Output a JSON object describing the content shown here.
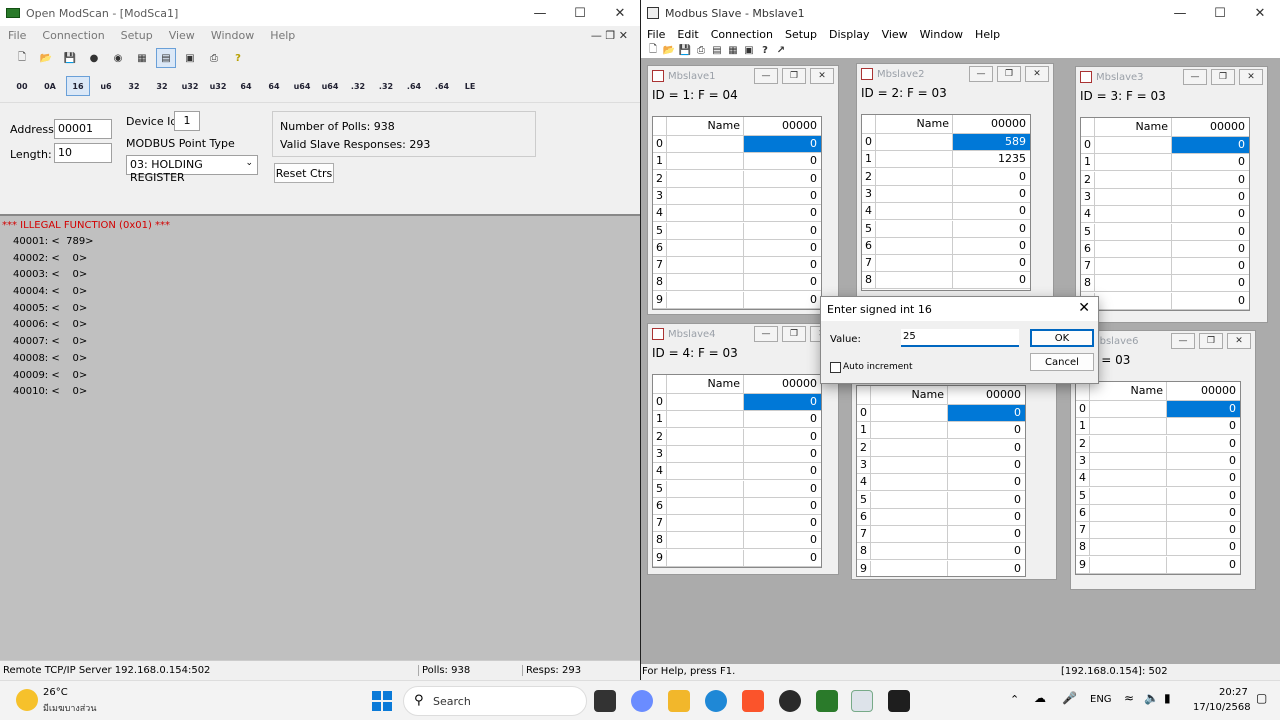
{
  "modscan": {
    "title": "Open ModScan - [ModSca1]",
    "menu": [
      "File",
      "Connection",
      "Setup",
      "View",
      "Window",
      "Help"
    ],
    "types": [
      "00",
      "0A",
      "16",
      "u6",
      "32",
      "32",
      "u32",
      "u32",
      "64",
      "64",
      "u64",
      "u64",
      ".32",
      ".32",
      ".64",
      ".64",
      "LE"
    ],
    "address_label": "Address:",
    "address": "00001",
    "length_label": "Length:",
    "length": "10",
    "device_id_label": "Device Id:",
    "device_id": "1",
    "point_type_label": "MODBUS Point Type",
    "point_type": "03: HOLDING REGISTER",
    "polls": "Number of Polls: 938",
    "valid": "Valid Slave Responses: 293",
    "reset": "Reset Ctrs",
    "error": "*** ILLEGAL FUNCTION (0x01) ***",
    "registers": [
      "40001: <  789>",
      "40002: <    0>",
      "40003: <    0>",
      "40004: <    0>",
      "40005: <    0>",
      "40006: <    0>",
      "40007: <    0>",
      "40008: <    0>",
      "40009: <    0>",
      "40010: <    0>"
    ],
    "status_server": "Remote TCP/IP Server 192.168.0.154:502",
    "status_polls": "Polls: 938",
    "status_resps": "Resps: 293"
  },
  "mbslave": {
    "title": "Modbus Slave - Mbslave1",
    "menu": [
      "File",
      "Edit",
      "Connection",
      "Setup",
      "Display",
      "View",
      "Window",
      "Help"
    ],
    "status_help": "For Help, press F1.",
    "status_addr": "[192.168.0.154]: 502",
    "slaves": [
      {
        "title": "Mbslave1",
        "id": "ID = 1: F = 04",
        "values": [
          "0",
          "0",
          "0",
          "0",
          "0",
          "0",
          "0",
          "0",
          "0",
          "0"
        ]
      },
      {
        "title": "Mbslave2",
        "id": "ID = 2: F = 03",
        "values": [
          "589",
          "1235",
          "0",
          "0",
          "0",
          "0",
          "0",
          "0",
          "0"
        ]
      },
      {
        "title": "Mbslave3",
        "id": "ID = 3: F = 03",
        "values": [
          "0",
          "0",
          "0",
          "0",
          "0",
          "0",
          "0",
          "0",
          "0",
          "0"
        ]
      },
      {
        "title": "Mbslave4",
        "id": "ID = 4: F = 03",
        "values": [
          "0",
          "0",
          "0",
          "0",
          "0",
          "0",
          "0",
          "0",
          "0",
          "0"
        ]
      },
      {
        "title": "",
        "id": "",
        "values": [
          "0",
          "0",
          "0",
          "0",
          "0",
          "0",
          "0",
          "0",
          "0",
          "0"
        ]
      },
      {
        "title": "Mbslave6",
        "id": "6: F = 03",
        "values": [
          "0",
          "0",
          "0",
          "0",
          "0",
          "0",
          "0",
          "0",
          "0",
          "0"
        ]
      }
    ],
    "col_name": "Name",
    "col_addr": "00000"
  },
  "dialog": {
    "title": "Enter signed int 16",
    "value_label": "Value:",
    "value": "25",
    "auto_increment": "Auto increment",
    "ok": "OK",
    "cancel": "Cancel"
  },
  "taskbar": {
    "temp": "26°C",
    "weather": "มีเมฆบางส่วน",
    "search": "Search",
    "lang": "ENG",
    "time": "20:27",
    "date": "17/10/2568"
  }
}
